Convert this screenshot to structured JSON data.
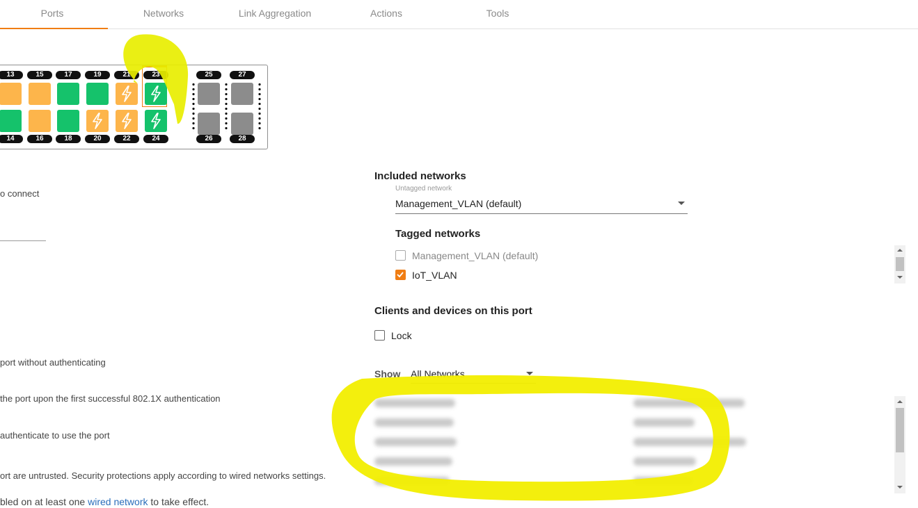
{
  "tabs": [
    "Ports",
    "Networks",
    "Link Aggregation",
    "Actions",
    "Tools"
  ],
  "ports": {
    "top_labels": [
      "13",
      "15",
      "17",
      "19",
      "21",
      "23",
      "25",
      "27"
    ],
    "bottom_labels": [
      "14",
      "16",
      "18",
      "20",
      "22",
      "24",
      "26",
      "28"
    ],
    "top_status": [
      "orange",
      "orange",
      "green",
      "green",
      "orange-poe",
      "green-poe",
      "gray",
      "gray"
    ],
    "bottom_status": [
      "green",
      "orange",
      "green",
      "orange-poe",
      "orange-poe",
      "green-poe",
      "gray",
      "gray"
    ],
    "selected": "23"
  },
  "left_texts": {
    "t1": "o connect",
    "t2": " port without authenticating",
    "t3": " the port upon the first successful 802.1X authentication",
    "t4": " authenticate to use the port",
    "t5": "ort are untrusted. Security protections apply according to wired networks settings.",
    "t6_pre": "bled on at least one ",
    "t6_link": "wired network",
    "t6_post": " to take effect."
  },
  "included": {
    "heading": "Included networks",
    "untagged_label": "Untagged network",
    "untagged_value": "Management_VLAN (default)",
    "tagged_heading": "Tagged networks",
    "tagged": [
      {
        "label": "Management_VLAN (default)",
        "checked": false
      },
      {
        "label": "IoT_VLAN",
        "checked": true
      }
    ]
  },
  "clients": {
    "heading": "Clients and devices on this port",
    "lock_label": "Lock",
    "show_label": "Show",
    "show_value": "All Networks"
  },
  "colors": {
    "accent": "#f07d13",
    "port_green": "#15c26b",
    "port_orange": "#fdb54b",
    "port_gray": "#8c8c8c",
    "highlight": "#f2ee00"
  }
}
